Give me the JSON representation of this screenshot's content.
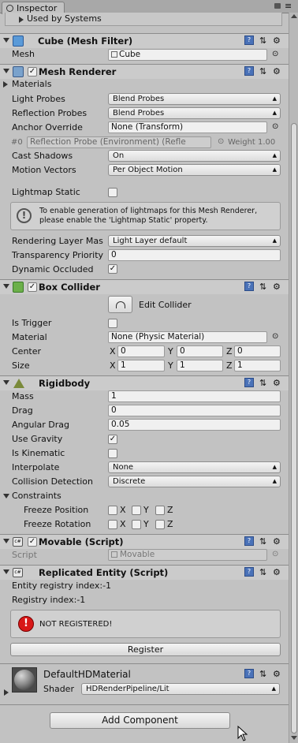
{
  "window": {
    "tab_title": "Inspector"
  },
  "used_by_systems": "Used by Systems",
  "mesh_filter": {
    "title": "Cube (Mesh Filter)",
    "mesh_label": "Mesh",
    "mesh_value": "Cube"
  },
  "mesh_renderer": {
    "title": "Mesh Renderer",
    "materials_label": "Materials",
    "light_probes_label": "Light Probes",
    "light_probes_value": "Blend Probes",
    "reflection_probes_label": "Reflection Probes",
    "reflection_probes_value": "Blend Probes",
    "anchor_override_label": "Anchor Override",
    "anchor_override_value": "None (Transform)",
    "probe_index": "#0",
    "probe_name": "Reflection Probe (Environment) (Refle",
    "probe_weight": "Weight 1.00",
    "cast_shadows_label": "Cast Shadows",
    "cast_shadows_value": "On",
    "motion_vectors_label": "Motion Vectors",
    "motion_vectors_value": "Per Object Motion",
    "lightmap_static_label": "Lightmap Static",
    "info_text_1": "To enable generation of lightmaps for this Mesh Renderer,",
    "info_text_2": "please enable the 'Lightmap Static' property.",
    "rendering_layer_label": "Rendering Layer Mas",
    "rendering_layer_value": "Light Layer default",
    "transparency_label": "Transparency Priority",
    "transparency_value": "0",
    "dynamic_occluded_label": "Dynamic Occluded"
  },
  "box_collider": {
    "title": "Box Collider",
    "edit_collider": "Edit Collider",
    "is_trigger_label": "Is Trigger",
    "material_label": "Material",
    "material_value": "None (Physic Material)",
    "center_label": "Center",
    "center": {
      "x": "0",
      "y": "0",
      "z": "0"
    },
    "size_label": "Size",
    "size": {
      "x": "1",
      "y": "1",
      "z": "1"
    },
    "axis_x": "X",
    "axis_y": "Y",
    "axis_z": "Z"
  },
  "rigidbody": {
    "title": "Rigidbody",
    "mass_label": "Mass",
    "mass_value": "1",
    "drag_label": "Drag",
    "drag_value": "0",
    "angular_drag_label": "Angular Drag",
    "angular_drag_value": "0.05",
    "use_gravity_label": "Use Gravity",
    "is_kinematic_label": "Is Kinematic",
    "interpolate_label": "Interpolate",
    "interpolate_value": "None",
    "collision_label": "Collision Detection",
    "collision_value": "Discrete",
    "constraints_label": "Constraints",
    "freeze_position_label": "Freeze Position",
    "freeze_rotation_label": "Freeze Rotation"
  },
  "movable": {
    "title": "Movable (Script)",
    "script_label": "Script",
    "script_value": "Movable"
  },
  "replicated": {
    "title": "Replicated Entity (Script)",
    "entity_index": "Entity registry index:-1",
    "registry_index": "Registry index:-1",
    "warning": "NOT REGISTERED!",
    "register_button": "Register"
  },
  "material": {
    "name": "DefaultHDMaterial",
    "shader_label": "Shader",
    "shader_value": "HDRenderPipeline/Lit"
  },
  "add_component": "Add Component",
  "icons": {
    "help": "?",
    "settings": "⚙",
    "presets": "⇅",
    "check": "✓"
  }
}
